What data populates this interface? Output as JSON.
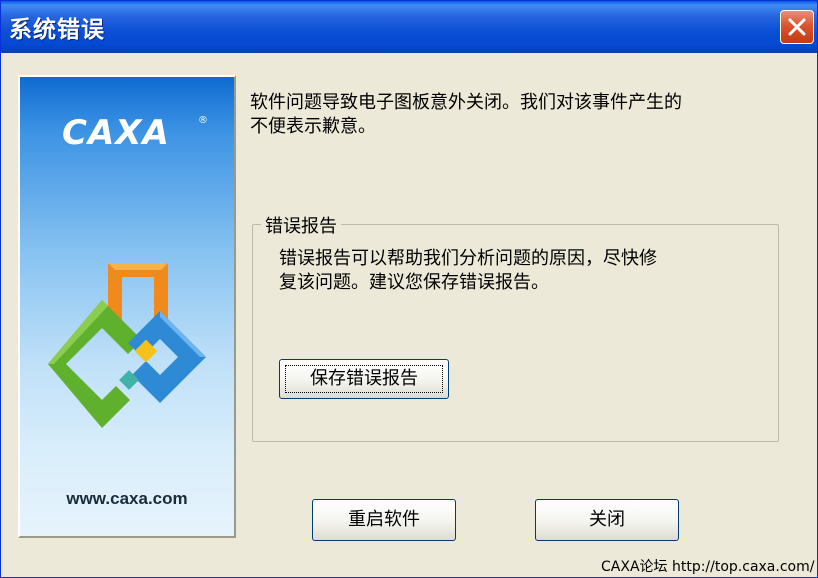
{
  "window": {
    "title": "系统错误",
    "close_icon": "close-icon"
  },
  "side_panel": {
    "logo": "CAXA",
    "logo_mark": "®",
    "url": "www.caxa.com"
  },
  "message": {
    "line1": "软件问题导致电子图板意外关闭。我们对该事件产生的",
    "line2": "不便表示歉意。"
  },
  "error_report": {
    "legend": "错误报告",
    "line1": "错误报告可以帮助我们分析问题的原因，尽快修",
    "line2": "复该问题。建议您保存错误报告。",
    "save_button": "保存错误报告"
  },
  "buttons": {
    "restart": "重启软件",
    "close": "关闭"
  },
  "watermark": "CAXA论坛 http://top.caxa.com/",
  "colors": {
    "titlebar": "#0548d2",
    "close_button": "#d9552f",
    "dialog_background": "#ece9d8"
  }
}
